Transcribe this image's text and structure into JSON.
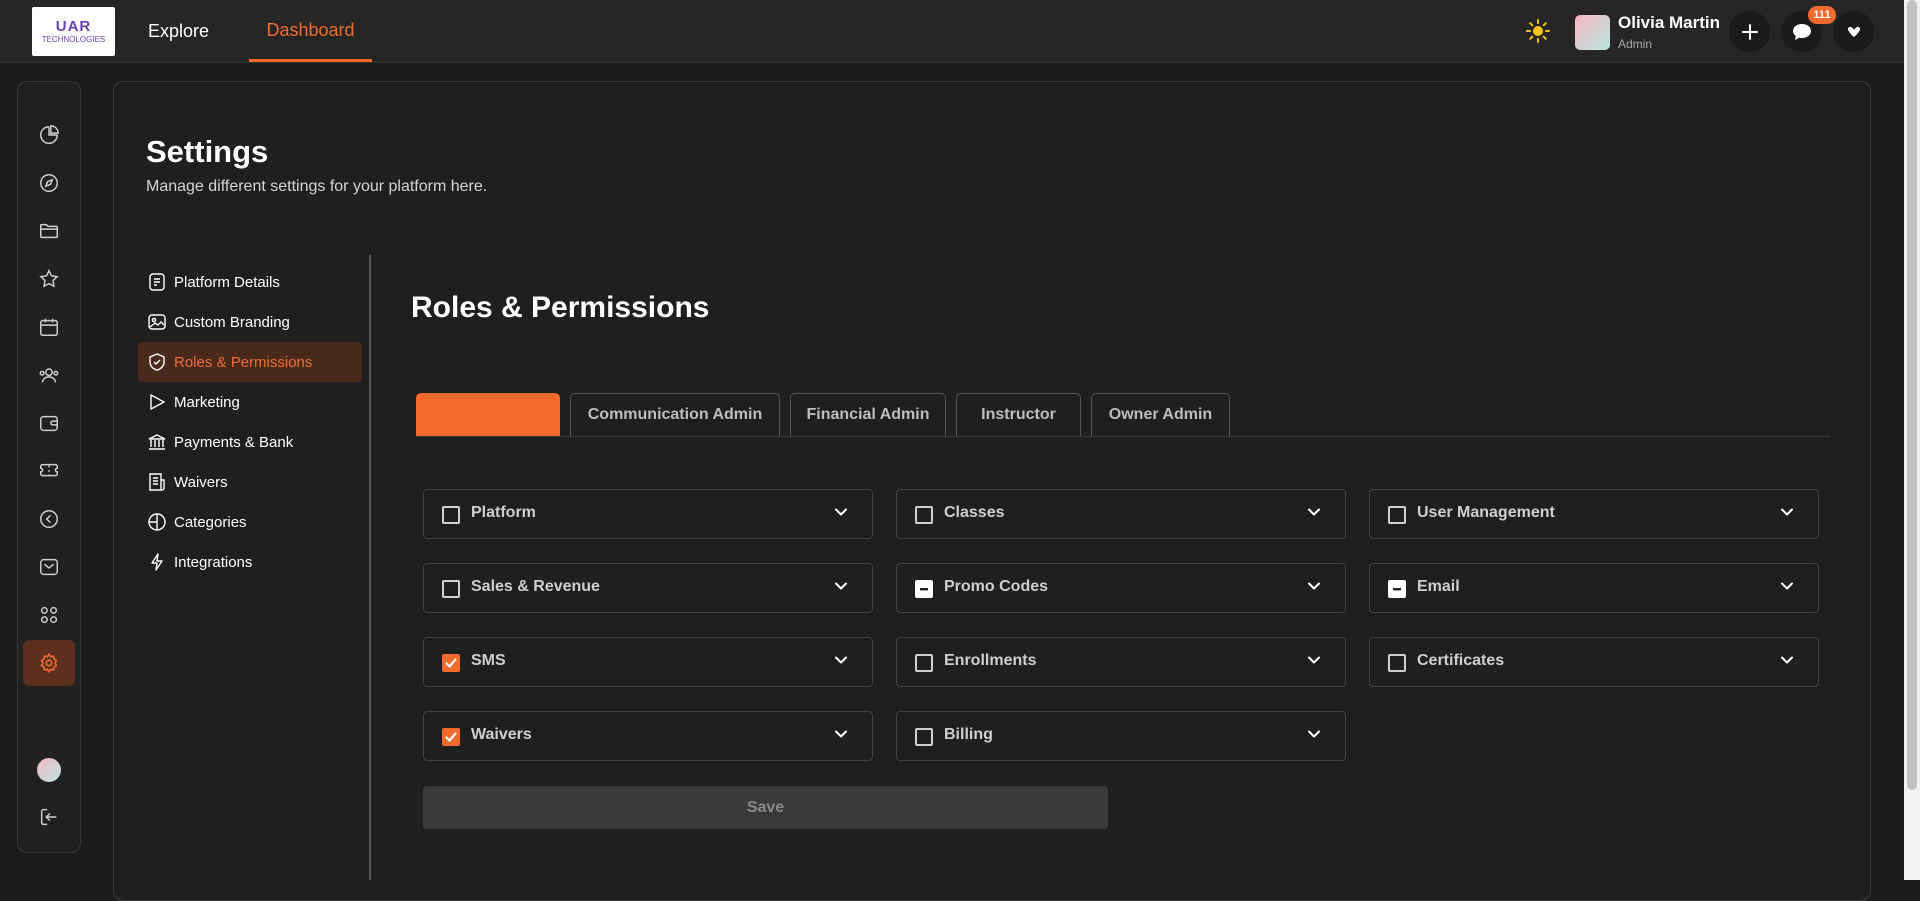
{
  "header": {
    "logo_line1": "UAR",
    "logo_line2": "TECHNOLOGIES",
    "nav": [
      {
        "label": "Explore"
      },
      {
        "label": "Dashboard"
      }
    ],
    "user": {
      "name": "Olivia Martin",
      "role": "Admin"
    },
    "chat_badge": "111",
    "icons": {
      "theme": "sun-icon",
      "add": "plus-icon",
      "chat": "chat-icon",
      "menu": "chevron-down-icon"
    }
  },
  "rail": {
    "items": [
      {
        "icon": "pie-chart-icon"
      },
      {
        "icon": "compass-icon"
      },
      {
        "icon": "folder-icon"
      },
      {
        "icon": "star-icon"
      },
      {
        "icon": "calendar-icon"
      },
      {
        "icon": "users-icon"
      },
      {
        "icon": "wallet-icon"
      },
      {
        "icon": "ticket-icon"
      },
      {
        "icon": "back-circle-icon"
      },
      {
        "icon": "mail-icon"
      },
      {
        "icon": "apps-icon"
      },
      {
        "icon": "gear-icon",
        "active": true
      }
    ],
    "bottom": [
      "avatar",
      "logout-icon"
    ]
  },
  "page": {
    "title": "Settings",
    "subtitle": "Manage different settings for your platform here."
  },
  "settings_menu": [
    {
      "label": "Platform Details",
      "icon": "document-icon"
    },
    {
      "label": "Custom Branding",
      "icon": "image-icon"
    },
    {
      "label": "Roles & Permissions",
      "icon": "shield-icon",
      "active": true
    },
    {
      "label": "Marketing",
      "icon": "play-icon"
    },
    {
      "label": "Payments & Bank",
      "icon": "bank-icon"
    },
    {
      "label": "Waivers",
      "icon": "receipt-icon"
    },
    {
      "label": "Categories",
      "icon": "globe-icon"
    },
    {
      "label": "Integrations",
      "icon": "bolt-icon"
    }
  ],
  "section": {
    "title": "Roles & Permissions",
    "tabs": [
      {
        "label": "",
        "active": true
      },
      {
        "label": "Communication Admin"
      },
      {
        "label": "Financial Admin"
      },
      {
        "label": "Instructor"
      },
      {
        "label": "Owner Admin"
      }
    ],
    "permissions": [
      {
        "label": "Platform",
        "state": "unchecked"
      },
      {
        "label": "Classes",
        "state": "unchecked"
      },
      {
        "label": "User Management",
        "state": "unchecked"
      },
      {
        "label": "Sales & Revenue",
        "state": "unchecked"
      },
      {
        "label": "Promo Codes",
        "state": "indeterminate"
      },
      {
        "label": "Email",
        "state": "indeterminate"
      },
      {
        "label": "SMS",
        "state": "checked"
      },
      {
        "label": "Enrollments",
        "state": "unchecked"
      },
      {
        "label": "Certificates",
        "state": "unchecked"
      },
      {
        "label": "Waivers",
        "state": "checked"
      },
      {
        "label": "Billing",
        "state": "unchecked"
      }
    ],
    "save_label": "Save"
  },
  "colors": {
    "accent": "#f26b2d",
    "background": "#1c1c1c",
    "panel": "#1f1f1f"
  }
}
